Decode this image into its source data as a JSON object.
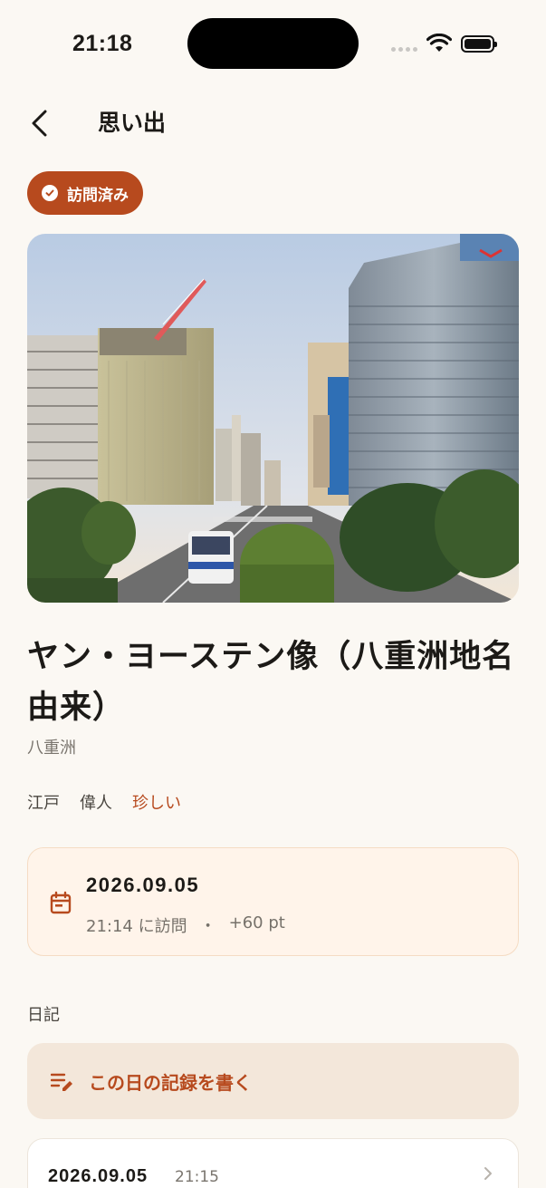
{
  "status_bar": {
    "time": "21:18"
  },
  "nav": {
    "title": "思い出"
  },
  "badge": {
    "label": "訪問済み"
  },
  "place": {
    "name": "ヤン・ヨーステン像（八重洲地名由来）",
    "area": "八重洲",
    "tags": [
      "江戸",
      "偉人",
      "珍しい"
    ]
  },
  "visit": {
    "date": "2026.09.05",
    "time_text": "21:14 に訪問",
    "separator": "・",
    "points": "+60 pt"
  },
  "diary": {
    "section_label": "日記",
    "write_label": "この日の記録を書く",
    "entries": [
      {
        "date": "2026.09.05",
        "time": "21:15"
      }
    ]
  },
  "colors": {
    "accent": "#b74a1e",
    "background": "#fbf8f3",
    "card_tint": "#fff4ea"
  }
}
